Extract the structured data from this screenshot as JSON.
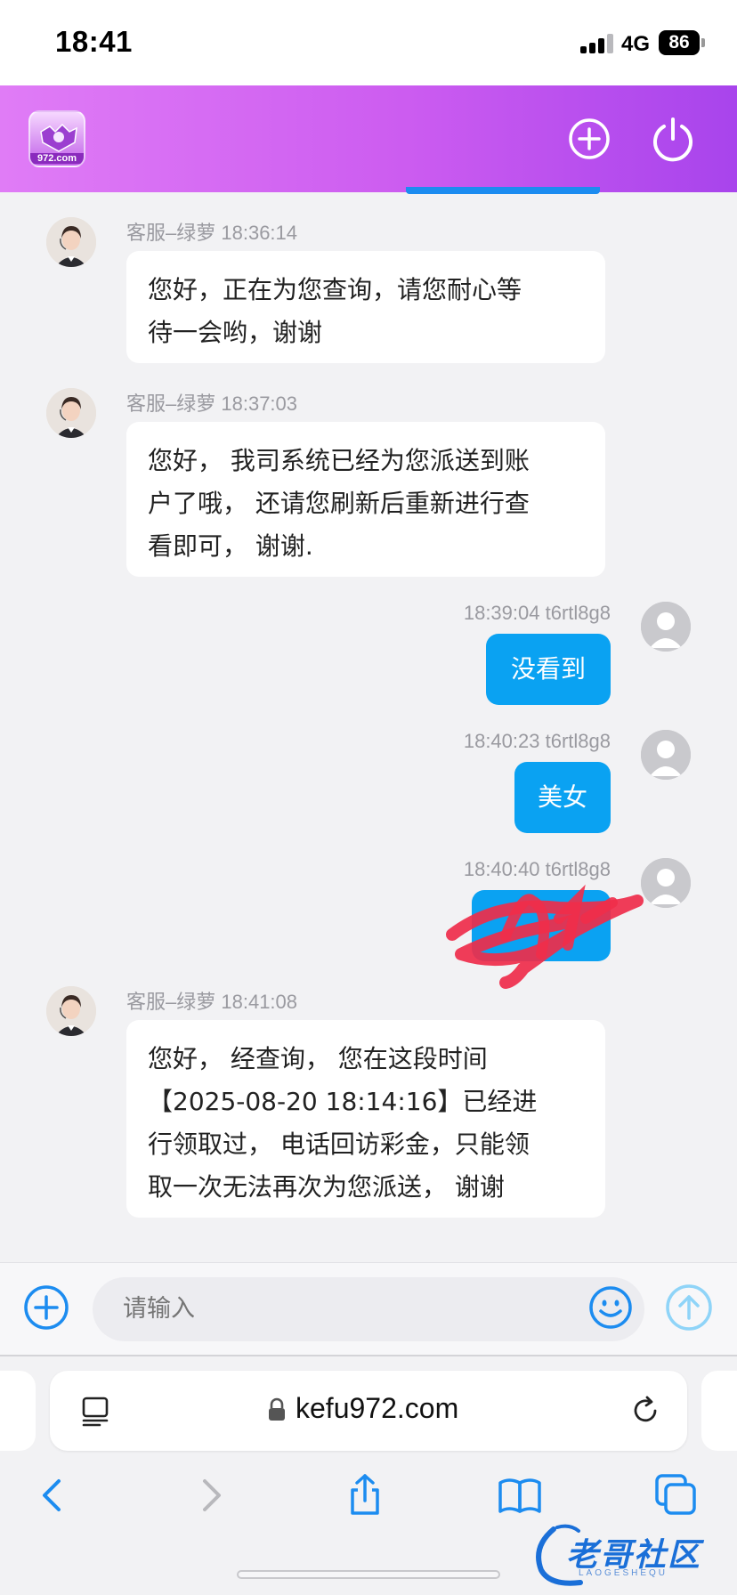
{
  "status_bar": {
    "time": "18:41",
    "network": "4G",
    "battery": "86"
  },
  "app": {
    "logo_text": "972.com"
  },
  "messages": [
    {
      "side": "in",
      "sender": "客服–绿萝",
      "time": "18:36:14",
      "lines": [
        "您好，正在为您查询，请您耐心等",
        "待一会哟，谢谢"
      ]
    },
    {
      "side": "in",
      "sender": "客服–绿萝",
      "time": "18:37:03",
      "lines": [
        "您好， 我司系统已经为您派送到账",
        "户了哦， 还请您刷新后重新进行查",
        "看即可， 谢谢."
      ]
    },
    {
      "side": "out",
      "sender": "t6rtl8g8",
      "time": "18:39:04",
      "text": "没看到"
    },
    {
      "side": "out",
      "sender": "t6rtl8g8",
      "time": "18:40:23",
      "text": "美女"
    },
    {
      "side": "out",
      "sender": "t6rtl8g8",
      "time": "18:40:40",
      "text": ""
    },
    {
      "side": "in",
      "sender": "客服–绿萝",
      "time": "18:41:08",
      "lines": [
        "您好， 经查询， 您在这段时间",
        "【2025-08-20 18:14:16】已经进",
        "行领取过， 电话回访彩金，只能领",
        "取一次无法再次为您派送， 谢谢"
      ]
    }
  ],
  "composer": {
    "placeholder": "请输入"
  },
  "browser": {
    "url": "kefu972.com"
  },
  "watermark": {
    "text": "老哥社区",
    "sub": "LAOGESHEQU"
  },
  "colors": {
    "header_start": "#e07cf6",
    "header_end": "#a844ec",
    "outgoing_bubble": "#0aa2f2",
    "accent_blue": "#1c8cf0"
  },
  "icons": [
    "logo",
    "add-circle-icon",
    "power-icon",
    "plus-circle-icon",
    "emoji-icon",
    "send-arrow-up-icon",
    "reader-icon",
    "lock-icon",
    "reload-icon",
    "back-icon",
    "forward-icon",
    "share-icon",
    "bookmarks-icon",
    "tabs-icon"
  ]
}
